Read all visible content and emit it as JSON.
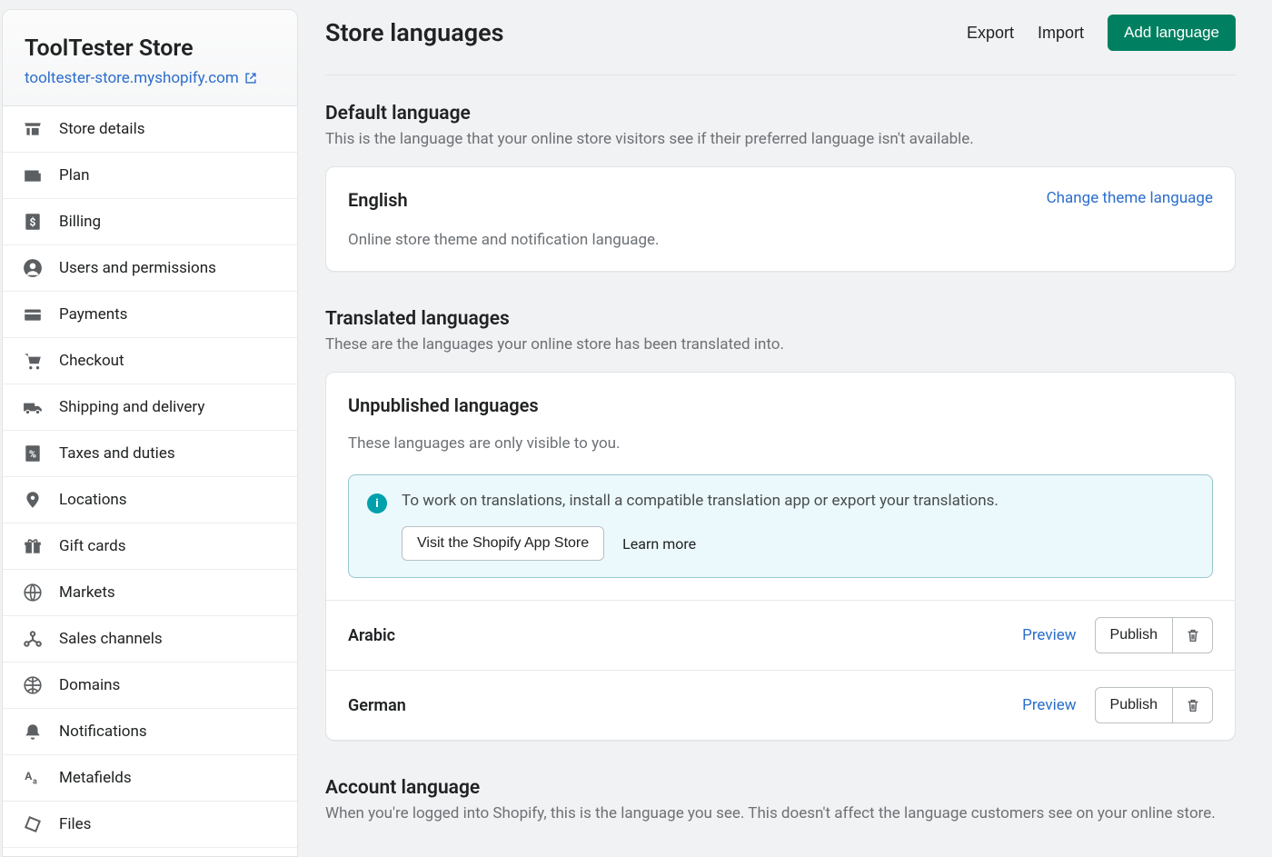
{
  "store": {
    "title": "ToolTester Store",
    "url": "tooltester-store.myshopify.com"
  },
  "sidebar": {
    "items": [
      {
        "label": "Store details"
      },
      {
        "label": "Plan"
      },
      {
        "label": "Billing"
      },
      {
        "label": "Users and permissions"
      },
      {
        "label": "Payments"
      },
      {
        "label": "Checkout"
      },
      {
        "label": "Shipping and delivery"
      },
      {
        "label": "Taxes and duties"
      },
      {
        "label": "Locations"
      },
      {
        "label": "Gift cards"
      },
      {
        "label": "Markets"
      },
      {
        "label": "Sales channels"
      },
      {
        "label": "Domains"
      },
      {
        "label": "Notifications"
      },
      {
        "label": "Metafields"
      },
      {
        "label": "Files"
      }
    ]
  },
  "header": {
    "title": "Store languages",
    "export": "Export",
    "import": "Import",
    "add": "Add language"
  },
  "defaultSection": {
    "title": "Default language",
    "desc": "This is the language that your online store visitors see if their preferred language isn't available.",
    "langName": "English",
    "changeLink": "Change theme language",
    "subDesc": "Online store theme and notification language."
  },
  "translatedSection": {
    "title": "Translated languages",
    "desc": "These are the languages your online store has been translated into.",
    "unpubTitle": "Unpublished languages",
    "unpubDesc": "These languages are only visible to you.",
    "banner": {
      "text": "To work on translations, install a compatible translation app or export your translations.",
      "visitBtn": "Visit the Shopify App Store",
      "learnMore": "Learn more"
    },
    "rows": [
      {
        "name": "Arabic",
        "preview": "Preview",
        "publish": "Publish"
      },
      {
        "name": "German",
        "preview": "Preview",
        "publish": "Publish"
      }
    ]
  },
  "accountSection": {
    "title": "Account language",
    "desc": "When you're logged into Shopify, this is the language you see. This doesn't affect the language customers see on your online store."
  }
}
